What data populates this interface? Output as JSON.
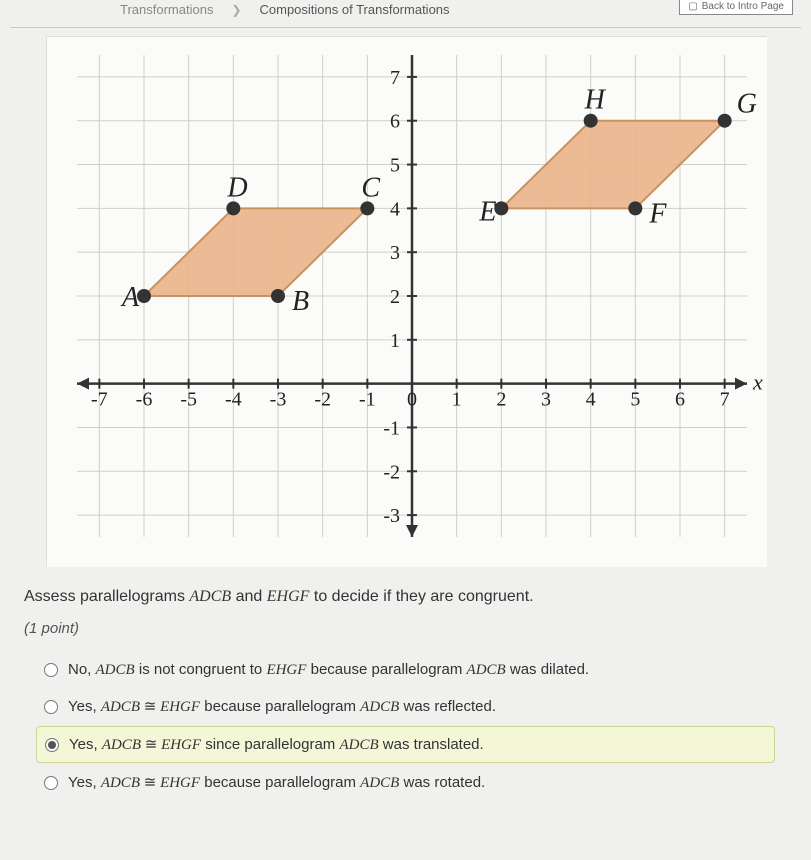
{
  "breadcrumb": {
    "prev": "Transformations",
    "current": "Compositions of Transformations"
  },
  "back_button": "Back to Intro Page",
  "chart_data": {
    "type": "scatter",
    "title": "",
    "xlabel": "x",
    "ylabel": "",
    "xlim": [
      -7.5,
      7.5
    ],
    "ylim": [
      -3.5,
      7.5
    ],
    "x_ticks": [
      -7,
      -6,
      -5,
      -4,
      -3,
      -2,
      -1,
      0,
      1,
      2,
      3,
      4,
      5,
      6,
      7
    ],
    "y_ticks": [
      -3,
      -2,
      -1,
      0,
      1,
      2,
      3,
      4,
      5,
      6,
      7
    ],
    "shapes": [
      {
        "name": "ADCB",
        "fill": "#e8a87c",
        "vertices": [
          {
            "label": "A",
            "x": -6,
            "y": 2
          },
          {
            "label": "D",
            "x": -4,
            "y": 4
          },
          {
            "label": "C",
            "x": -1,
            "y": 4
          },
          {
            "label": "B",
            "x": -3,
            "y": 2
          }
        ]
      },
      {
        "name": "EHGF",
        "fill": "#e8a87c",
        "vertices": [
          {
            "label": "E",
            "x": 2,
            "y": 4
          },
          {
            "label": "H",
            "x": 4,
            "y": 6
          },
          {
            "label": "G",
            "x": 7,
            "y": 6
          },
          {
            "label": "F",
            "x": 5,
            "y": 4
          }
        ]
      }
    ]
  },
  "question": {
    "prefix": "Assess parallelograms ",
    "shape1": "ADCB",
    "mid": " and ",
    "shape2": "EHGF",
    "suffix": " to decide if they are congruent."
  },
  "points_label": "(1 point)",
  "options": [
    {
      "prefix": "No, ",
      "s1": "ADCB",
      "mid": " is not congruent to ",
      "s2": "EHGF",
      "tail": " because parallelogram ",
      "s3": "ADCB",
      "end": " was dilated.",
      "selected": false
    },
    {
      "prefix": "Yes, ",
      "s1": "ADCB",
      "cong": " ≅ ",
      "s2": "EHGF",
      "tail": " because parallelogram ",
      "s3": "ADCB",
      "end": " was reflected.",
      "selected": false
    },
    {
      "prefix": "Yes, ",
      "s1": "ADCB",
      "cong": " ≅ ",
      "s2": "EHGF",
      "tail": " since parallelogram ",
      "s3": "ADCB",
      "end": " was translated.",
      "selected": true
    },
    {
      "prefix": "Yes, ",
      "s1": "ADCB",
      "cong": " ≅ ",
      "s2": "EHGF",
      "tail": " because parallelogram ",
      "s3": "ADCB",
      "end": " was rotated.",
      "selected": false
    }
  ]
}
